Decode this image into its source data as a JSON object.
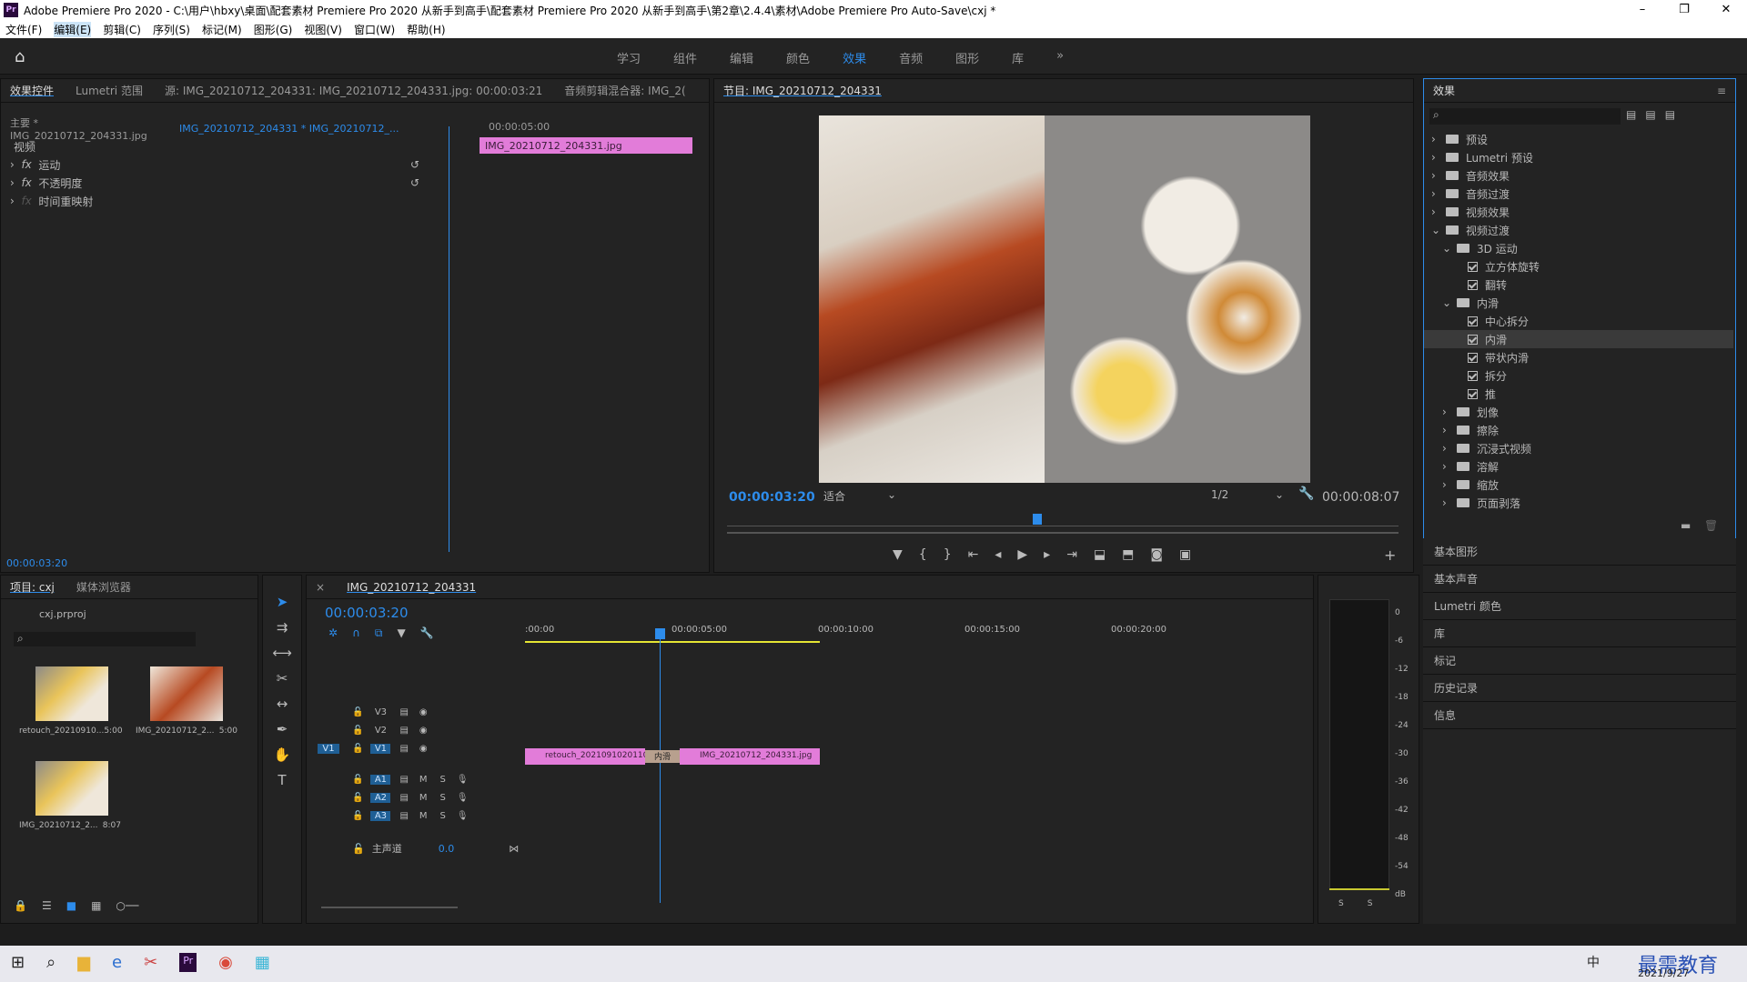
{
  "window": {
    "title": "Adobe Premiere Pro 2020 - C:\\用户\\hbxy\\桌面\\配套素材 Premiere Pro 2020 从新手到高手\\配套素材 Premiere Pro 2020 从新手到高手\\第2章\\2.4.4\\素材\\Adobe Premiere Pro Auto-Save\\cxj *",
    "app_badge": "Pr",
    "min": "–",
    "max": "❐",
    "close": "✕"
  },
  "menu": [
    "文件(F)",
    "编辑(E)",
    "剪辑(C)",
    "序列(S)",
    "标记(M)",
    "图形(G)",
    "视图(V)",
    "窗口(W)",
    "帮助(H)"
  ],
  "workspaces": {
    "items": [
      "学习",
      "组件",
      "编辑",
      "颜色",
      "效果",
      "音频",
      "图形",
      "库"
    ],
    "active": "效果",
    "more": "»"
  },
  "effect_controls": {
    "tabs": [
      "效果控件",
      "Lumetri 范围",
      "源: IMG_20210712_204331: IMG_20210712_204331.jpg: 00:00:03:21",
      "音频剪辑混合器: IMG_2("
    ],
    "master": "主要 * IMG_20210712_204331.jpg",
    "seq": "IMG_20210712_204331 * IMG_20210712_...",
    "ruler_time": "00:00:05:00",
    "clip": "IMG_20210712_204331.jpg",
    "section": "视频",
    "effects": [
      "运动",
      "不透明度",
      "时间重映射"
    ],
    "fx": "fx",
    "timecode": "00:00:03:20"
  },
  "program": {
    "title": "节目: IMG_20210712_204331",
    "timecode": "00:00:03:20",
    "fit": "适合",
    "res": "1/2",
    "duration": "00:00:08:07"
  },
  "effects_panel": {
    "title": "效果",
    "tree": [
      {
        "label": "预设",
        "level": 0,
        "type": "folder"
      },
      {
        "label": "Lumetri 预设",
        "level": 0,
        "type": "folder"
      },
      {
        "label": "音频效果",
        "level": 0,
        "type": "folder"
      },
      {
        "label": "音频过渡",
        "level": 0,
        "type": "folder"
      },
      {
        "label": "视频效果",
        "level": 0,
        "type": "folder"
      },
      {
        "label": "视频过渡",
        "level": 0,
        "type": "folder",
        "open": true
      },
      {
        "label": "3D 运动",
        "level": 1,
        "type": "folder",
        "open": true
      },
      {
        "label": "立方体旋转",
        "level": 2,
        "type": "item"
      },
      {
        "label": "翻转",
        "level": 2,
        "type": "item"
      },
      {
        "label": "内滑",
        "level": 1,
        "type": "folder",
        "open": true
      },
      {
        "label": "中心拆分",
        "level": 2,
        "type": "item"
      },
      {
        "label": "内滑",
        "level": 2,
        "type": "item",
        "selected": true
      },
      {
        "label": "带状内滑",
        "level": 2,
        "type": "item"
      },
      {
        "label": "拆分",
        "level": 2,
        "type": "item"
      },
      {
        "label": "推",
        "level": 2,
        "type": "item"
      },
      {
        "label": "划像",
        "level": 1,
        "type": "folder"
      },
      {
        "label": "擦除",
        "level": 1,
        "type": "folder"
      },
      {
        "label": "沉浸式视频",
        "level": 1,
        "type": "folder"
      },
      {
        "label": "溶解",
        "level": 1,
        "type": "folder"
      },
      {
        "label": "缩放",
        "level": 1,
        "type": "folder"
      },
      {
        "label": "页面剥落",
        "level": 1,
        "type": "folder"
      }
    ],
    "panels": [
      "基本图形",
      "基本声音",
      "Lumetri 颜色",
      "库",
      "标记",
      "历史记录",
      "信息"
    ]
  },
  "project": {
    "tabs": [
      "项目: cxj",
      "媒体浏览器"
    ],
    "file": "cxj.prproj",
    "items": [
      {
        "name": "retouch_20210910...",
        "dur": "5:00"
      },
      {
        "name": "IMG_20210712_2...",
        "dur": "5:00"
      },
      {
        "name": "IMG_20210712_2...",
        "dur": "8:07"
      }
    ]
  },
  "timeline": {
    "tab": "IMG_20210712_204331",
    "timecode": "00:00:03:20",
    "ruler": [
      ":00:00",
      "00:00:05:00",
      "00:00:10:00",
      "00:00:15:00",
      "00:00:20:00"
    ],
    "tracks": [
      "V3",
      "V2",
      "V1",
      "A1",
      "A2",
      "A3"
    ],
    "src": "V1",
    "master": "主声道",
    "master_val": "0.0",
    "m": "M",
    "s": "S",
    "clip1": "retouch_2021091020110",
    "clip2": "IMG_20210712_204331.jpg",
    "transition": "内滑"
  },
  "meter": {
    "scale": [
      "0",
      "-6",
      "-12",
      "-18",
      "-24",
      "-30",
      "-36",
      "-42",
      "-48",
      "-54",
      "dB"
    ],
    "s": "S"
  },
  "taskbar": {
    "time": "2021/9/27",
    "ime": "中",
    "badge": "最需教育"
  },
  "colors": {
    "accent": "#2d8ceb",
    "clip": "#e27cd9",
    "bg": "#232323"
  }
}
